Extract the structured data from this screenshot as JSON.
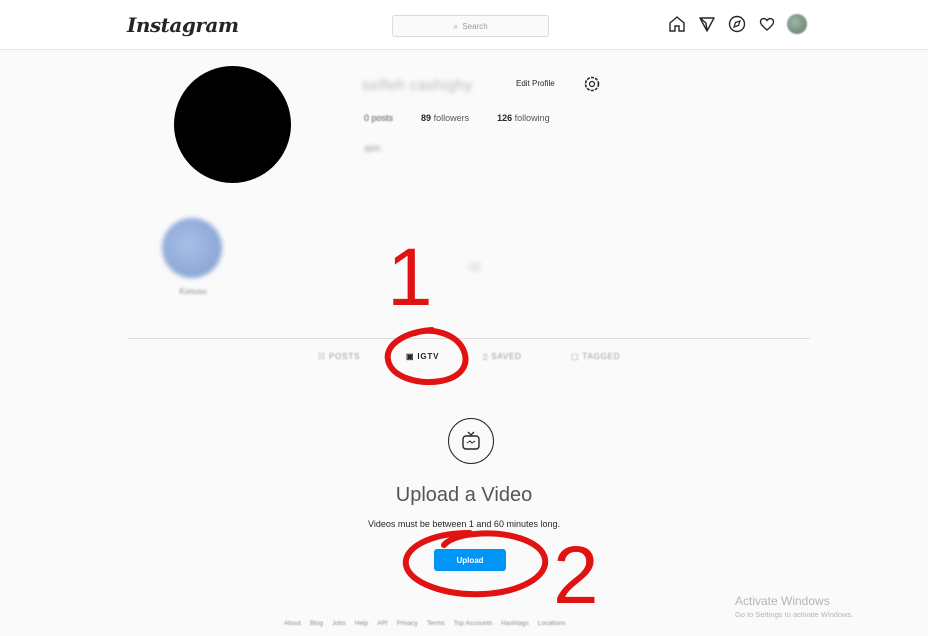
{
  "header": {
    "logo": "Instagram",
    "search_placeholder": "Search"
  },
  "profile": {
    "username": "selfeh cashighy",
    "edit_profile_label": "Edit Profile",
    "posts_count": "0",
    "posts_label": "posts",
    "followers_count": "89",
    "followers_label": "followers",
    "following_count": "126",
    "following_label": "following",
    "bio": "apis"
  },
  "highlight": {
    "label": "Konusu"
  },
  "tabs": [
    {
      "label": "POSTS",
      "icon": "grid-icon",
      "active": false
    },
    {
      "label": "IGTV",
      "icon": "igtv-icon",
      "active": true
    },
    {
      "label": "SAVED",
      "icon": "bookmark-icon",
      "active": false
    },
    {
      "label": "TAGGED",
      "icon": "tag-icon",
      "active": false
    }
  ],
  "empty_state": {
    "title": "Upload a Video",
    "subtitle": "Videos must be between 1 and 60 minutes long.",
    "upload_button": "Upload"
  },
  "footer": {
    "links": [
      "About",
      "Blog",
      "Jobs",
      "Help",
      "API",
      "Privacy",
      "Terms",
      "Top Accounts",
      "Hashtags",
      "Locations"
    ]
  },
  "watermark": {
    "title": "Activate Windows",
    "subtitle": "Go to Settings to activate Windows."
  },
  "annotations": {
    "step1": "1",
    "step2": "2"
  },
  "colors": {
    "accent": "#0095f6",
    "annotation": "#e01212"
  }
}
